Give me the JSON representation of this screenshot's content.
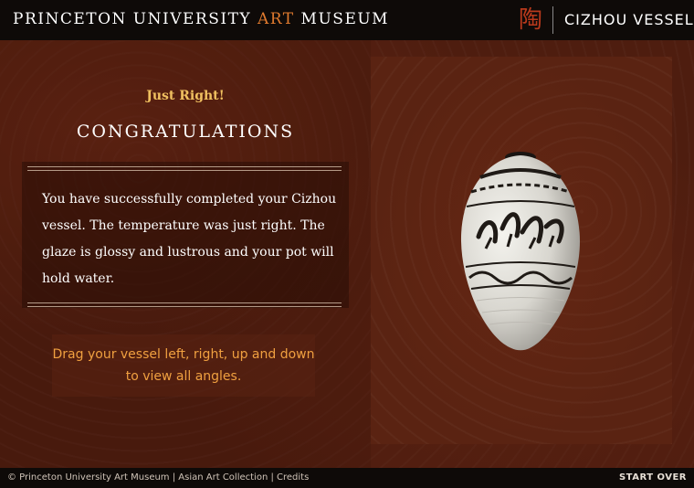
{
  "header": {
    "museum_name_1": "PRINCETON UNIVERSITY ",
    "museum_name_art": "ART",
    "museum_name_2": " MUSEUM",
    "seal_glyph": "陶",
    "vessel_title": "CIZHOU VESSEL"
  },
  "result": {
    "subtitle": "Just Right!",
    "headline": "CONGRATULATIONS",
    "message": "You have successfully completed your Cizhou vessel.  The temperature was just right.  The glaze is glossy and lustrous and your pot will hold water.",
    "hint": "Drag your vessel left, right, up and down to view all angles."
  },
  "footer": {
    "copyright": "© Princeton University Art Museum",
    "sep1": " | ",
    "collection": "Asian Art Collection",
    "sep2": " | ",
    "credits": "Credits",
    "start_over": "START OVER"
  },
  "colors": {
    "accent": "#e07a2e",
    "subtitle": "#f0c060",
    "hint": "#f0a040",
    "seal": "#b8391c"
  },
  "icons": {
    "seal": "chinese-seal-icon",
    "vessel": "cizhou-vessel-image"
  }
}
